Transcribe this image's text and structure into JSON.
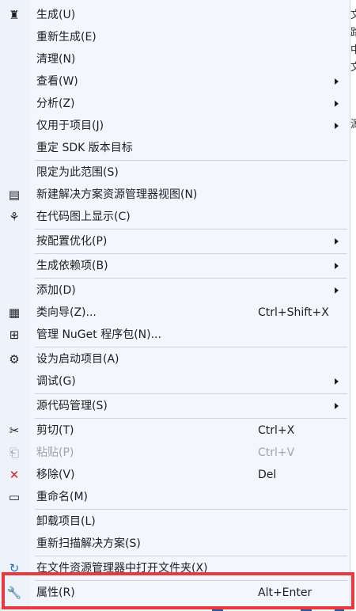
{
  "menu": {
    "items": [
      {
        "type": "item",
        "name": "build",
        "label": "生成(U)",
        "icon": "build-icon",
        "glyph": "♜"
      },
      {
        "type": "item",
        "name": "rebuild",
        "label": "重新生成(E)"
      },
      {
        "type": "item",
        "name": "clean",
        "label": "清理(N)"
      },
      {
        "type": "item",
        "name": "view",
        "label": "查看(W)",
        "submenu": true
      },
      {
        "type": "item",
        "name": "analyze",
        "label": "分析(Z)",
        "submenu": true
      },
      {
        "type": "item",
        "name": "project-only",
        "label": "仅用于项目(J)",
        "submenu": true
      },
      {
        "type": "item",
        "name": "retarget-sdk",
        "label": "重定 SDK 版本目标"
      },
      {
        "type": "sep"
      },
      {
        "type": "item",
        "name": "scope-to-this",
        "label": "限定为此范围(S)"
      },
      {
        "type": "item",
        "name": "new-solution-explorer-view",
        "label": "新建解决方案资源管理器视图(N)",
        "icon": "new-view-icon",
        "glyph": "▤"
      },
      {
        "type": "item",
        "name": "show-on-code-map",
        "label": "在代码图上显示(C)",
        "icon": "code-map-icon",
        "glyph": "⚘"
      },
      {
        "type": "sep"
      },
      {
        "type": "item",
        "name": "profile-guided-optimization",
        "label": "按配置优化(P)",
        "submenu": true
      },
      {
        "type": "sep"
      },
      {
        "type": "item",
        "name": "build-dependencies",
        "label": "生成依赖项(B)",
        "submenu": true
      },
      {
        "type": "sep"
      },
      {
        "type": "item",
        "name": "add",
        "label": "添加(D)",
        "submenu": true
      },
      {
        "type": "item",
        "name": "class-wizard",
        "label": "类向导(Z)...",
        "shortcut": "Ctrl+Shift+X",
        "icon": "class-wizard-icon",
        "glyph": "▦"
      },
      {
        "type": "item",
        "name": "manage-nuget",
        "label": "管理 NuGet 程序包(N)...",
        "icon": "nuget-icon",
        "glyph": "⊞"
      },
      {
        "type": "sep"
      },
      {
        "type": "item",
        "name": "set-startup-project",
        "label": "设为启动项目(A)",
        "icon": "gear-icon",
        "glyph": "⚙"
      },
      {
        "type": "item",
        "name": "debug",
        "label": "调试(G)",
        "submenu": true
      },
      {
        "type": "sep"
      },
      {
        "type": "item",
        "name": "source-control",
        "label": "源代码管理(S)",
        "submenu": true
      },
      {
        "type": "sep"
      },
      {
        "type": "item",
        "name": "cut",
        "label": "剪切(T)",
        "shortcut": "Ctrl+X",
        "icon": "scissors-icon",
        "glyph": "✂"
      },
      {
        "type": "item",
        "name": "paste",
        "label": "粘贴(P)",
        "shortcut": "Ctrl+V",
        "icon": "paste-icon",
        "glyph": "⎗",
        "disabled": true
      },
      {
        "type": "item",
        "name": "remove",
        "label": "移除(V)",
        "shortcut": "Del",
        "icon": "remove-icon",
        "glyph": "✕",
        "glyph_color": "#d1242f"
      },
      {
        "type": "item",
        "name": "rename",
        "label": "重命名(M)",
        "icon": "rename-icon",
        "glyph": "▭"
      },
      {
        "type": "sep"
      },
      {
        "type": "item",
        "name": "unload-project",
        "label": "卸载项目(L)"
      },
      {
        "type": "item",
        "name": "rescan-solution",
        "label": "重新扫描解决方案(S)"
      },
      {
        "type": "sep"
      },
      {
        "type": "item",
        "name": "open-folder-in-explorer",
        "label": "在文件资源管理器中打开文件夹(X)",
        "icon": "refresh-icon",
        "glyph": "↻",
        "glyph_color": "#1e6fc3"
      },
      {
        "type": "sep"
      },
      {
        "type": "item",
        "name": "properties",
        "label": "属性(R)",
        "shortcut": "Alt+Enter",
        "icon": "wrench-icon",
        "glyph": "🔧"
      }
    ]
  },
  "right_strip": {
    "chars": [
      "文",
      "路",
      "中",
      "文",
      "",
      "",
      "源"
    ]
  },
  "colors": {
    "highlight_border": "#e83a3c",
    "menu_background": "#f3f6fc"
  }
}
